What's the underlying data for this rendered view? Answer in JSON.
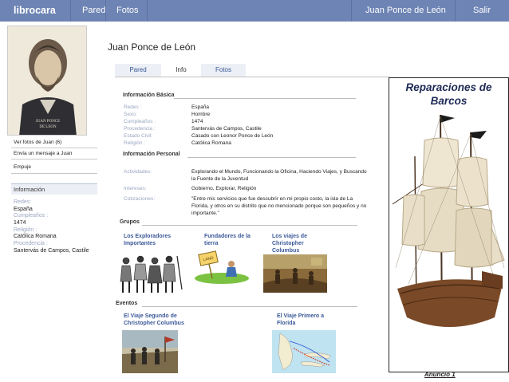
{
  "nav": {
    "brand": "librocara",
    "links": [
      "Pared",
      "Fotos"
    ],
    "user": "Juan Ponce de León",
    "logout": "Salir"
  },
  "sidebar": {
    "links": [
      "Ver fotos de Juan (6)",
      "Envía un mensaje a Juan",
      "Empuje"
    ],
    "info_header": "Información",
    "info": {
      "redes_label": "Redes:",
      "redes_value": "España",
      "cumple_label": "Cumpleaños :",
      "cumple_value": "1474",
      "religion_label": "Religión :",
      "religion_value": "Católica Romana",
      "procedencia_label": "Procedencia :",
      "procedencia_value": "Santervás de Campos, Castile"
    }
  },
  "main": {
    "title": "Juan Ponce de León",
    "tabs": [
      "Pared",
      "Info",
      "Fotos"
    ],
    "active_tab": "Info",
    "basic": {
      "heading": "Información Básica",
      "rows": [
        {
          "k": "Redes :",
          "v": "España"
        },
        {
          "k": "Sexo:",
          "v": "Hombre"
        },
        {
          "k": "Cumpleaños :",
          "v": " 1474"
        },
        {
          "k": "Procedencia :",
          "v": "Santervás de Campos, Castile"
        },
        {
          "k": "Estado Civil:",
          "v": " Casado con Leonor Ponce de León"
        },
        {
          "k": "Religión :",
          "v": "Católica Romana"
        }
      ]
    },
    "personal": {
      "heading": "Información Personal",
      "actividades_k": "Actividades:",
      "actividades_v": "Explorando el Mundo, Funcionando la Oficina, Haciendo Viajes, y Buscando la Fuente de la Juventud",
      "intereses_k": "Intereses:",
      "intereses_v": "Gobierno, Explorar, Religión",
      "citas_k": "Cotizaciones:",
      "citas_v": "\"Entre mis servicios que fue descubrir en mi propio costo, la isla de La Florida, y otros en su distrito que no mencionado  porque son pequeños y no importante.\""
    },
    "groups": {
      "heading": "Grupos",
      "items": [
        "Los Exploradores Importantes",
        "Fundadores de la tierra",
        "Los viajes de Christopher Columbus"
      ]
    },
    "events": {
      "heading": "Eventos",
      "items": [
        "El Viaje Segundo de Christopher Columbus",
        "El Viaje Primero a Florida"
      ]
    }
  },
  "ad": {
    "title": "Reparaciones de Barcos",
    "footer": "Anuncio 1"
  },
  "colors": {
    "nav_bg": "#6d84b4",
    "link": "#3b5998",
    "label": "#9aa6c0"
  }
}
